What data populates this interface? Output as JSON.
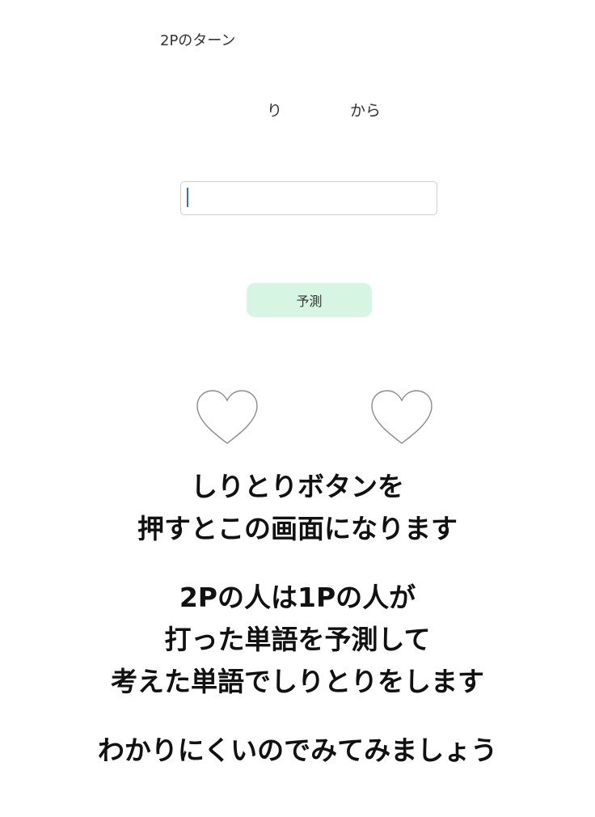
{
  "screen": {
    "turn_label": "2Pのターン",
    "prompt_char": "り",
    "prompt_suffix": "から",
    "input": {
      "value": "",
      "placeholder": ""
    },
    "predict_button_label": "予測",
    "hearts": [
      {
        "icon": "heart-outline-icon"
      },
      {
        "icon": "heart-outline-icon"
      }
    ]
  },
  "captions": {
    "block1": [
      "しりとりボタンを",
      "押すとこの画面になります"
    ],
    "block2": [
      "2Pの人は1Pの人が",
      "打った単語を予測して",
      "考えた単語でしりとりをします"
    ],
    "block3": [
      "わかりにくいのでみてみましょう"
    ]
  },
  "colors": {
    "button_bg": "#d6f5e3",
    "caret": "#2b6de8",
    "heart_stroke": "#8a8a8a"
  }
}
